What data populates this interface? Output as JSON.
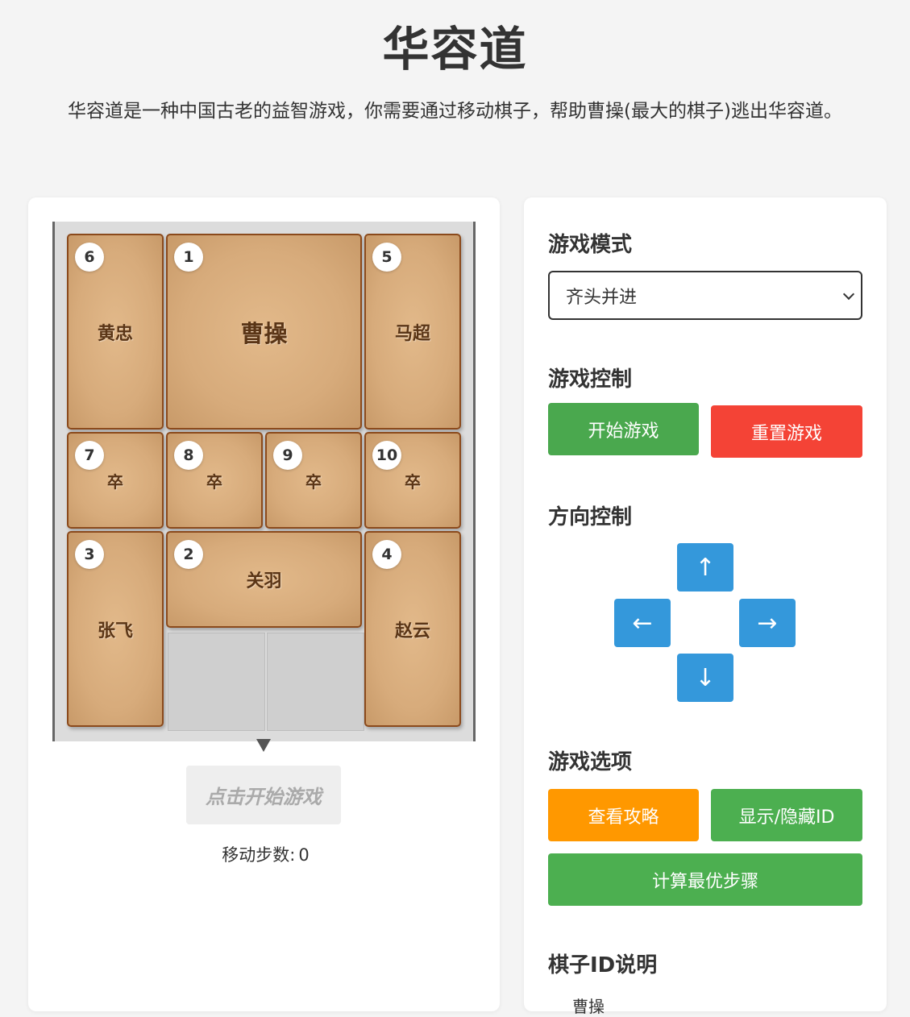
{
  "header": {
    "title": "华容道",
    "subtitle": "华容道是一种中国古老的益智游戏，你需要通过移动棋子，帮助曹操(最大的棋子)逃出华容道。"
  },
  "board": {
    "pieces": [
      {
        "id": "6",
        "name": "黄忠"
      },
      {
        "id": "1",
        "name": "曹操"
      },
      {
        "id": "5",
        "name": "马超"
      },
      {
        "id": "7",
        "name": "卒"
      },
      {
        "id": "8",
        "name": "卒"
      },
      {
        "id": "9",
        "name": "卒"
      },
      {
        "id": "10",
        "name": "卒"
      },
      {
        "id": "3",
        "name": "张飞"
      },
      {
        "id": "2",
        "name": "关羽"
      },
      {
        "id": "4",
        "name": "赵云"
      }
    ],
    "start_hint": "点击开始游戏",
    "move_count_label": "移动步数:",
    "move_count": "0"
  },
  "sidebar": {
    "mode_title": "游戏模式",
    "mode_selected": "齐头并进",
    "control_title": "游戏控制",
    "start_label": "开始游戏",
    "reset_label": "重置游戏",
    "direction_title": "方向控制",
    "arrows": {
      "up": "↑",
      "left": "←",
      "right": "→",
      "down": "↓"
    },
    "options_title": "游戏选项",
    "guide_label": "查看攻略",
    "toggle_id_label": "显示/隐藏ID",
    "solve_label": "计算最优步骤",
    "id_info_title": "棋子ID说明",
    "id_info_first": "曹操"
  },
  "colors": {
    "piece_border": "#8b4a1c",
    "start_green": "#4aa84e",
    "reset_red": "#f44336",
    "guide_orange": "#ff9800",
    "arrow_blue": "#3498db"
  }
}
